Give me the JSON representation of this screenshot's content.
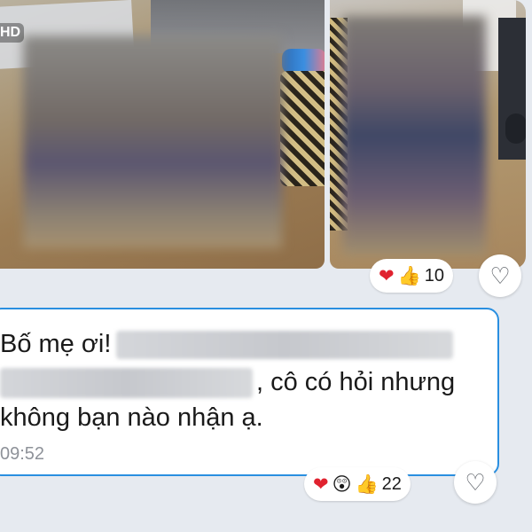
{
  "photos": {
    "hd_badge": "HD"
  },
  "reactions_top": {
    "icons": [
      "heart-icon",
      "thumbs-up-icon"
    ],
    "heart": "❤",
    "thumb": "👍",
    "count": "10"
  },
  "message": {
    "line1_visible": "Bố mẹ ơi!",
    "line2_visible": ", cô có hỏi nhưng",
    "line3": "không bạn nào nhận ạ.",
    "time": "09:52"
  },
  "reactions_bottom": {
    "icons": [
      "heart-icon",
      "surprised-face-icon",
      "thumbs-up-icon"
    ],
    "heart": "❤",
    "wow": "😲",
    "thumb": "👍",
    "count": "22"
  },
  "like_button_glyph": "♡",
  "colors": {
    "bubble_border": "#2a8fe0",
    "background": "#e6eaf0",
    "heart": "#e0222f"
  }
}
